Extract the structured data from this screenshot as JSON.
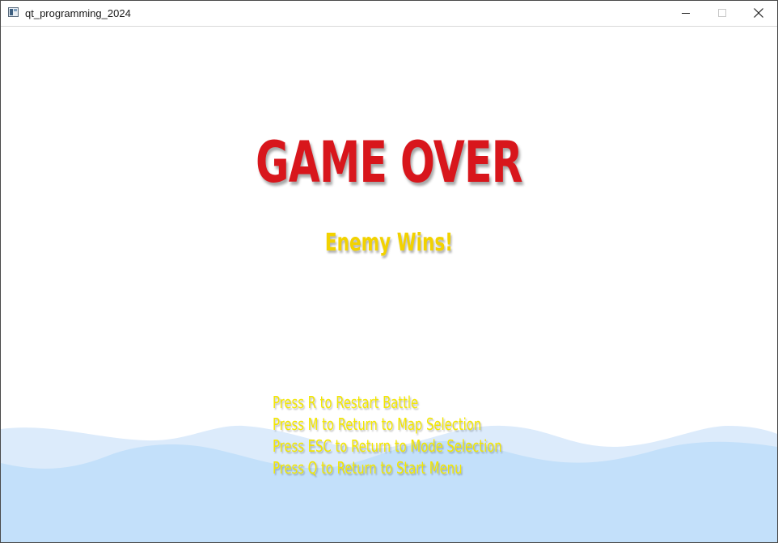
{
  "window": {
    "title": "qt_programming_2024"
  },
  "game": {
    "headline": "GAME OVER",
    "result": "Enemy Wins!",
    "instructions": [
      "Press R to Restart Battle",
      "Press M to Return to Map Selection",
      "Press ESC to Return to Mode Selection",
      "Press Q to Return to Start Menu"
    ],
    "colors": {
      "headline": "#d8161c",
      "result": "#f2d200",
      "instructions": "#f2e600",
      "water_back": "#dcebfb",
      "water_front": "#c3e0fa"
    }
  }
}
